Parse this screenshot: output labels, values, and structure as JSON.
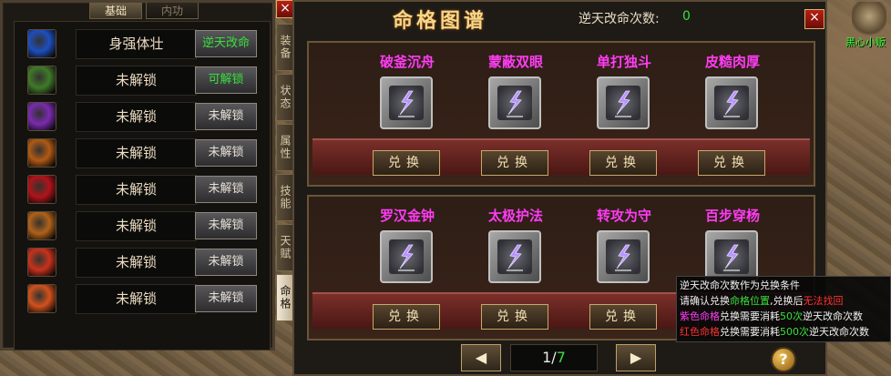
{
  "left_panel": {
    "tabs": [
      {
        "label": "基础",
        "active": true
      },
      {
        "label": "内功",
        "active": false
      }
    ],
    "close_label": "×",
    "skills": [
      {
        "name": "身强体壮",
        "button": "逆天改命",
        "button_color": "#37e03a",
        "icon": "blue-paw-icon",
        "color": "#1d4fbf"
      },
      {
        "name": "未解锁",
        "button": "可解锁",
        "button_color": "#37e03a",
        "icon": "green-beast-icon",
        "color": "#3f7a2a"
      },
      {
        "name": "未解锁",
        "button": "未解锁",
        "button_color": "#e8e2d6",
        "icon": "purple-swirl-icon",
        "color": "#7a2bb0"
      },
      {
        "name": "未解锁",
        "button": "未解锁",
        "button_color": "#e8e2d6",
        "icon": "fire-figure-icon",
        "color": "#b05a14"
      },
      {
        "name": "未解锁",
        "button": "未解锁",
        "button_color": "#e8e2d6",
        "icon": "red-orb-icon",
        "color": "#b0141a"
      },
      {
        "name": "未解锁",
        "button": "未解锁",
        "button_color": "#e8e2d6",
        "icon": "orange-beast-icon",
        "color": "#b0621a"
      },
      {
        "name": "未解锁",
        "button": "未解锁",
        "button_color": "#e8e2d6",
        "icon": "red-rune-icon",
        "color": "#c8321c"
      },
      {
        "name": "未解锁",
        "button": "未解锁",
        "button_color": "#e8e2d6",
        "icon": "fire-claw-icon",
        "color": "#d2521c"
      }
    ],
    "side_tabs": [
      "装备",
      "状态",
      "属性",
      "技能",
      "天赋",
      "命格"
    ]
  },
  "fate_panel": {
    "title": "命格图谱",
    "count_label": "逆天改命次数:",
    "count_value": "0",
    "close_label": "×",
    "row1": [
      "破釜沉舟",
      "蒙蔽双眼",
      "单打独斗",
      "皮糙肉厚"
    ],
    "row2": [
      "罗汉金钟",
      "太极护法",
      "转攻为守",
      "百步穿杨"
    ],
    "exchange_label": "兑换",
    "pager": {
      "prev": "◀",
      "next": "▶",
      "current": "1",
      "separator": "/",
      "total": "7"
    },
    "help_label": "?"
  },
  "tooltip": {
    "line1": "逆天改命次数作为兑换条件",
    "line2_a": "请确认兑换",
    "line2_b": "命格位置",
    "line2_c": ",兑换后",
    "line2_d": "无法找回",
    "line3_a": "紫色命格",
    "line3_b": "兑换需要消耗",
    "line3_c": "50次",
    "line3_d": "逆天改命次数",
    "line4_a": "红色命格",
    "line4_b": "兑换需要消耗",
    "line4_c": "500次",
    "line4_d": "逆天改命次数"
  },
  "world": {
    "npc_name": "黑心小贩"
  }
}
